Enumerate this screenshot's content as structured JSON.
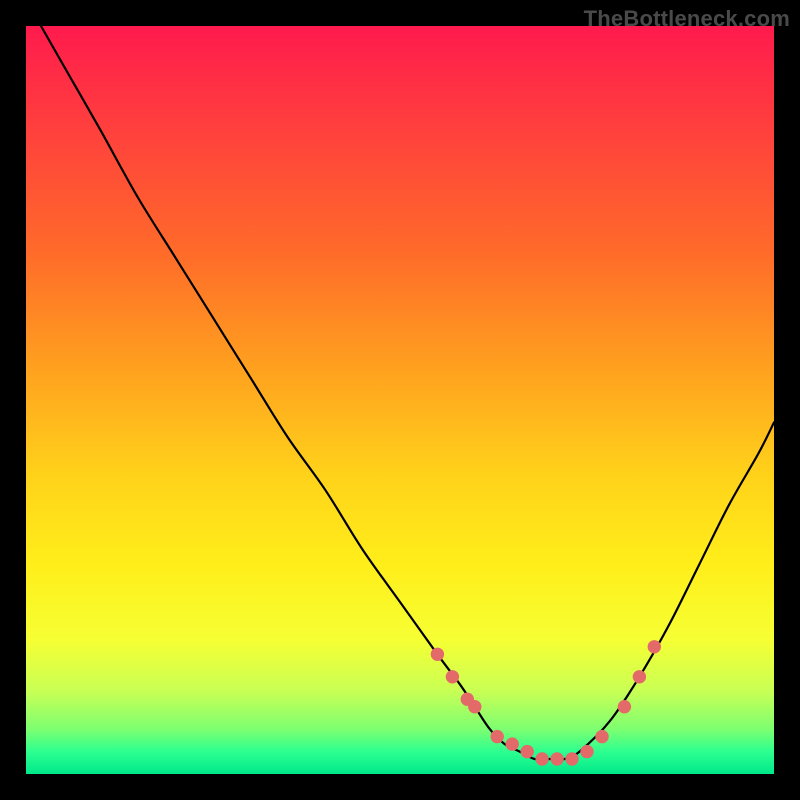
{
  "watermark": "TheBottleneck.com",
  "chart_data": {
    "type": "line",
    "title": "",
    "xlabel": "",
    "ylabel": "",
    "xlim": [
      0,
      100
    ],
    "ylim": [
      0,
      100
    ],
    "grid": false,
    "series": [
      {
        "name": "curve",
        "color": "#000000",
        "x": [
          2,
          6,
          10,
          15,
          20,
          25,
          30,
          35,
          40,
          45,
          50,
          55,
          58,
          60,
          62,
          64,
          66,
          68,
          70,
          72,
          74,
          78,
          82,
          86,
          90,
          94,
          98,
          100
        ],
        "values": [
          100,
          93,
          86,
          77,
          69,
          61,
          53,
          45,
          38,
          30,
          23,
          16,
          12,
          9,
          6,
          4,
          3,
          2,
          2,
          2,
          3,
          7,
          13,
          20,
          28,
          36,
          43,
          47
        ]
      }
    ],
    "markers": {
      "name": "highlight-points",
      "color": "#e46a6a",
      "radius_pct": 0.9,
      "x": [
        55,
        57,
        59,
        60,
        63,
        65,
        67,
        69,
        71,
        73,
        75,
        77,
        80,
        82,
        84
      ],
      "values": [
        16,
        13,
        10,
        9,
        5,
        4,
        3,
        2,
        2,
        2,
        3,
        5,
        9,
        13,
        17
      ]
    }
  }
}
